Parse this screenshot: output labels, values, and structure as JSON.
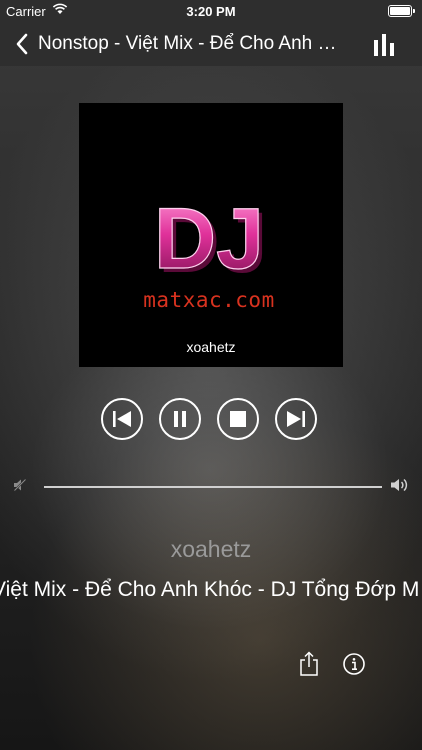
{
  "status_bar": {
    "carrier": "Carrier",
    "time": "3:20 PM"
  },
  "nav": {
    "title": "Nonstop - Việt Mix - Để Cho Anh Khóc - DJ Tổng Đớp M",
    "back_icon": "chevron-left-icon",
    "equalizer_icon": "equalizer-icon"
  },
  "artwork": {
    "logo_text": "DJ",
    "site_text": "matxac.com",
    "caption": "xoahetz"
  },
  "controls": {
    "previous_icon": "skip-previous-icon",
    "pause_icon": "pause-icon",
    "stop_icon": "stop-icon",
    "next_icon": "skip-next-icon"
  },
  "volume": {
    "level": 1.0
  },
  "track": {
    "artist": "xoahetz",
    "song_title": "Việt Mix - Để Cho Anh Khóc - DJ Tổng Đớp M"
  },
  "actions": {
    "share_icon": "share-icon",
    "info_icon": "info-icon"
  },
  "colors": {
    "logo_pink": "#e0319a",
    "site_red": "#d8321f"
  }
}
